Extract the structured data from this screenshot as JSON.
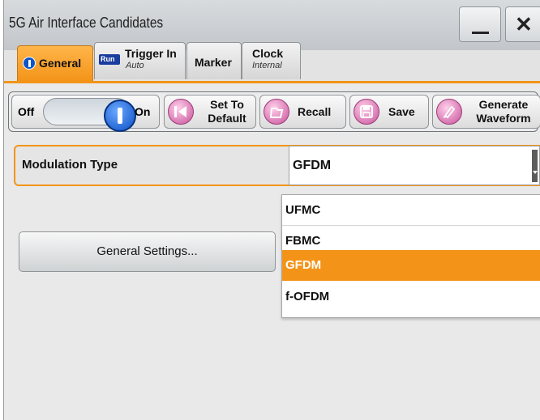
{
  "window": {
    "title": "5G Air Interface Candidates",
    "minimize_icon": "minimize-icon",
    "close_label": "✕"
  },
  "tabs": [
    {
      "label": "General",
      "sub": "",
      "icon": "info-icon"
    },
    {
      "label": "Trigger In",
      "sub": "Auto",
      "icon": "run-icon",
      "icon_text": "Run"
    },
    {
      "label": "Marker",
      "sub": ""
    },
    {
      "label": "Clock",
      "sub": "Internal"
    }
  ],
  "toolbar": {
    "toggle": {
      "off_label": "Off",
      "on_label": "On",
      "state": "on"
    },
    "set_default": {
      "line1": "Set To",
      "line2": "Default",
      "icon": "set-default-icon"
    },
    "recall": {
      "label": "Recall",
      "icon": "recall-icon"
    },
    "save": {
      "label": "Save",
      "icon": "save-icon"
    },
    "generate": {
      "line1": "Generate",
      "line2": "Waveform",
      "icon": "generate-waveform-icon"
    }
  },
  "modulation": {
    "label": "Modulation Type",
    "value": "GFDM",
    "options": [
      "UFMC",
      "FBMC",
      "GFDM",
      "f-OFDM"
    ],
    "selected_option": "GFDM"
  },
  "general_settings_label": "General Settings...",
  "colors": {
    "accent": "#f39419",
    "knob": "#0b4fc4"
  }
}
